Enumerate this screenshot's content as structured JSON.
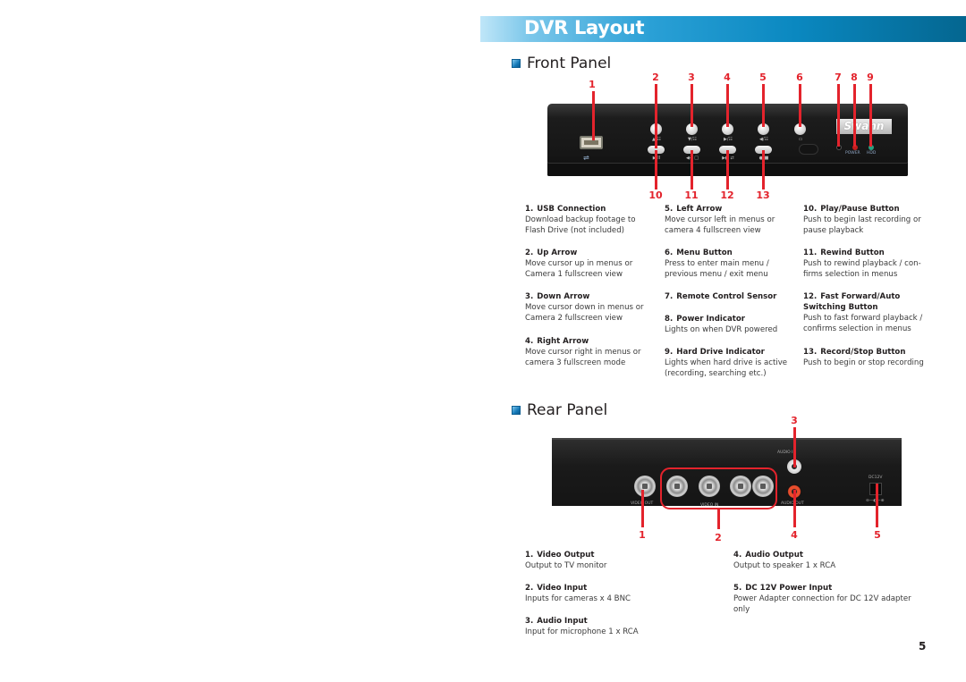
{
  "page": {
    "title": "DVR Layout",
    "page_number": "5",
    "colors": {
      "accent_blue": "#0a88c0",
      "callout_red": "#e3232c",
      "text": "#231f20"
    }
  },
  "front_panel": {
    "heading": "Front Panel",
    "callouts_top": [
      "1",
      "2",
      "3",
      "4",
      "5",
      "6",
      "7",
      "8",
      "9"
    ],
    "callouts_bottom": [
      "10",
      "11",
      "12",
      "13"
    ],
    "device": {
      "brand": "Swann",
      "power_label": "POWER",
      "hdd_label": "HDD",
      "usb_icon": "usb-icon",
      "button_sublabels": [
        "▲/☷",
        "▼/☷",
        "▶/☷",
        "◀/☷",
        "▭"
      ],
      "pill_sublabels": [
        "▶ II",
        "◀◀ □",
        "▶▶ ⇄",
        "● ■"
      ]
    },
    "items": [
      {
        "num": "1.",
        "title": "USB Connection",
        "desc": [
          "Download backup footage to",
          "Flash Drive (not included)"
        ]
      },
      {
        "num": "2.",
        "title": "Up Arrow",
        "desc": [
          "Move cursor up in menus or",
          "Camera 1 fullscreen view"
        ]
      },
      {
        "num": "3.",
        "title": "Down Arrow",
        "desc": [
          "Move cursor down in menus or",
          "Camera 2 fullscreen view"
        ]
      },
      {
        "num": "4.",
        "title": "Right Arrow",
        "desc": [
          "Move cursor right in menus or",
          "camera 3 fullscreen mode"
        ]
      },
      {
        "num": "5.",
        "title": "Left Arrow",
        "desc": [
          "Move cursor left in menus or",
          "camera 4 fullscreen view"
        ]
      },
      {
        "num": "6.",
        "title": "Menu Button",
        "desc": [
          "Press to enter main menu /",
          "previous menu / exit menu"
        ]
      },
      {
        "num": "7.",
        "title": "Remote Control Sensor",
        "desc": []
      },
      {
        "num": "8.",
        "title": "Power Indicator",
        "desc": [
          "Lights on when DVR powered"
        ]
      },
      {
        "num": "9.",
        "title": "Hard Drive Indicator",
        "desc": [
          "Lights when hard drive is active",
          "(recording, searching etc.)"
        ]
      },
      {
        "num": "10.",
        "title": "Play/Pause Button",
        "desc": [
          "Push to begin last recording or",
          "pause playback"
        ]
      },
      {
        "num": "11.",
        "title": "Rewind Button",
        "desc": [
          "Push to rewind playback / con-",
          "firms selection in menus"
        ]
      },
      {
        "num": "12.",
        "title": "Fast Forward/Auto",
        "title2": "Switching Button",
        "desc": [
          "Push to fast forward playback /",
          "confirms selection in menus"
        ]
      },
      {
        "num": "13.",
        "title": "Record/Stop Button",
        "desc": [
          "Push to begin or stop recording"
        ]
      }
    ]
  },
  "rear_panel": {
    "heading": "Rear Panel",
    "callouts": [
      "1",
      "2",
      "3",
      "4",
      "5"
    ],
    "device": {
      "video_out_label": "VIDEO OUT",
      "video_in_label": "VIDEO IN",
      "audio_in_label": "AUDIO IN",
      "audio_out_label": "AUDIO OUT",
      "dc_label": "DC12V",
      "polarity_label": "⊖—◐—⊕"
    },
    "items": [
      {
        "num": "1.",
        "title": "Video Output",
        "desc": [
          "Output to TV monitor"
        ]
      },
      {
        "num": "2.",
        "title": "Video Input",
        "desc": [
          "Inputs for cameras x 4 BNC"
        ]
      },
      {
        "num": "3.",
        "title": "Audio Input",
        "desc": [
          "Input for microphone 1 x RCA"
        ]
      },
      {
        "num": "4.",
        "title": "Audio Output",
        "desc": [
          "Output to speaker 1 x RCA"
        ]
      },
      {
        "num": "5.",
        "title": "DC 12V Power Input",
        "desc": [
          "Power Adapter connection for DC 12V adapter",
          "only"
        ]
      }
    ]
  }
}
